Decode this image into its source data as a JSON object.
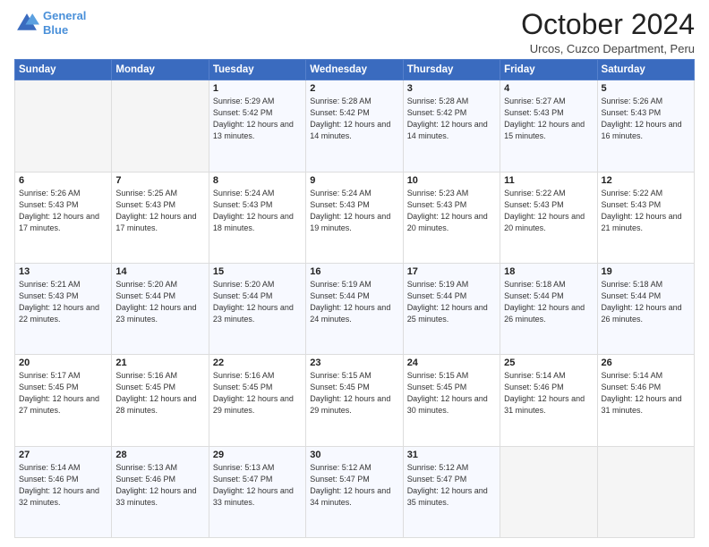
{
  "header": {
    "logo_line1": "General",
    "logo_line2": "Blue",
    "month_title": "October 2024",
    "location": "Urcos, Cuzco Department, Peru"
  },
  "weekdays": [
    "Sunday",
    "Monday",
    "Tuesday",
    "Wednesday",
    "Thursday",
    "Friday",
    "Saturday"
  ],
  "weeks": [
    [
      {
        "day": "",
        "sunrise": "",
        "sunset": "",
        "daylight": ""
      },
      {
        "day": "",
        "sunrise": "",
        "sunset": "",
        "daylight": ""
      },
      {
        "day": "1",
        "sunrise": "Sunrise: 5:29 AM",
        "sunset": "Sunset: 5:42 PM",
        "daylight": "Daylight: 12 hours and 13 minutes."
      },
      {
        "day": "2",
        "sunrise": "Sunrise: 5:28 AM",
        "sunset": "Sunset: 5:42 PM",
        "daylight": "Daylight: 12 hours and 14 minutes."
      },
      {
        "day": "3",
        "sunrise": "Sunrise: 5:28 AM",
        "sunset": "Sunset: 5:42 PM",
        "daylight": "Daylight: 12 hours and 14 minutes."
      },
      {
        "day": "4",
        "sunrise": "Sunrise: 5:27 AM",
        "sunset": "Sunset: 5:43 PM",
        "daylight": "Daylight: 12 hours and 15 minutes."
      },
      {
        "day": "5",
        "sunrise": "Sunrise: 5:26 AM",
        "sunset": "Sunset: 5:43 PM",
        "daylight": "Daylight: 12 hours and 16 minutes."
      }
    ],
    [
      {
        "day": "6",
        "sunrise": "Sunrise: 5:26 AM",
        "sunset": "Sunset: 5:43 PM",
        "daylight": "Daylight: 12 hours and 17 minutes."
      },
      {
        "day": "7",
        "sunrise": "Sunrise: 5:25 AM",
        "sunset": "Sunset: 5:43 PM",
        "daylight": "Daylight: 12 hours and 17 minutes."
      },
      {
        "day": "8",
        "sunrise": "Sunrise: 5:24 AM",
        "sunset": "Sunset: 5:43 PM",
        "daylight": "Daylight: 12 hours and 18 minutes."
      },
      {
        "day": "9",
        "sunrise": "Sunrise: 5:24 AM",
        "sunset": "Sunset: 5:43 PM",
        "daylight": "Daylight: 12 hours and 19 minutes."
      },
      {
        "day": "10",
        "sunrise": "Sunrise: 5:23 AM",
        "sunset": "Sunset: 5:43 PM",
        "daylight": "Daylight: 12 hours and 20 minutes."
      },
      {
        "day": "11",
        "sunrise": "Sunrise: 5:22 AM",
        "sunset": "Sunset: 5:43 PM",
        "daylight": "Daylight: 12 hours and 20 minutes."
      },
      {
        "day": "12",
        "sunrise": "Sunrise: 5:22 AM",
        "sunset": "Sunset: 5:43 PM",
        "daylight": "Daylight: 12 hours and 21 minutes."
      }
    ],
    [
      {
        "day": "13",
        "sunrise": "Sunrise: 5:21 AM",
        "sunset": "Sunset: 5:43 PM",
        "daylight": "Daylight: 12 hours and 22 minutes."
      },
      {
        "day": "14",
        "sunrise": "Sunrise: 5:20 AM",
        "sunset": "Sunset: 5:44 PM",
        "daylight": "Daylight: 12 hours and 23 minutes."
      },
      {
        "day": "15",
        "sunrise": "Sunrise: 5:20 AM",
        "sunset": "Sunset: 5:44 PM",
        "daylight": "Daylight: 12 hours and 23 minutes."
      },
      {
        "day": "16",
        "sunrise": "Sunrise: 5:19 AM",
        "sunset": "Sunset: 5:44 PM",
        "daylight": "Daylight: 12 hours and 24 minutes."
      },
      {
        "day": "17",
        "sunrise": "Sunrise: 5:19 AM",
        "sunset": "Sunset: 5:44 PM",
        "daylight": "Daylight: 12 hours and 25 minutes."
      },
      {
        "day": "18",
        "sunrise": "Sunrise: 5:18 AM",
        "sunset": "Sunset: 5:44 PM",
        "daylight": "Daylight: 12 hours and 26 minutes."
      },
      {
        "day": "19",
        "sunrise": "Sunrise: 5:18 AM",
        "sunset": "Sunset: 5:44 PM",
        "daylight": "Daylight: 12 hours and 26 minutes."
      }
    ],
    [
      {
        "day": "20",
        "sunrise": "Sunrise: 5:17 AM",
        "sunset": "Sunset: 5:45 PM",
        "daylight": "Daylight: 12 hours and 27 minutes."
      },
      {
        "day": "21",
        "sunrise": "Sunrise: 5:16 AM",
        "sunset": "Sunset: 5:45 PM",
        "daylight": "Daylight: 12 hours and 28 minutes."
      },
      {
        "day": "22",
        "sunrise": "Sunrise: 5:16 AM",
        "sunset": "Sunset: 5:45 PM",
        "daylight": "Daylight: 12 hours and 29 minutes."
      },
      {
        "day": "23",
        "sunrise": "Sunrise: 5:15 AM",
        "sunset": "Sunset: 5:45 PM",
        "daylight": "Daylight: 12 hours and 29 minutes."
      },
      {
        "day": "24",
        "sunrise": "Sunrise: 5:15 AM",
        "sunset": "Sunset: 5:45 PM",
        "daylight": "Daylight: 12 hours and 30 minutes."
      },
      {
        "day": "25",
        "sunrise": "Sunrise: 5:14 AM",
        "sunset": "Sunset: 5:46 PM",
        "daylight": "Daylight: 12 hours and 31 minutes."
      },
      {
        "day": "26",
        "sunrise": "Sunrise: 5:14 AM",
        "sunset": "Sunset: 5:46 PM",
        "daylight": "Daylight: 12 hours and 31 minutes."
      }
    ],
    [
      {
        "day": "27",
        "sunrise": "Sunrise: 5:14 AM",
        "sunset": "Sunset: 5:46 PM",
        "daylight": "Daylight: 12 hours and 32 minutes."
      },
      {
        "day": "28",
        "sunrise": "Sunrise: 5:13 AM",
        "sunset": "Sunset: 5:46 PM",
        "daylight": "Daylight: 12 hours and 33 minutes."
      },
      {
        "day": "29",
        "sunrise": "Sunrise: 5:13 AM",
        "sunset": "Sunset: 5:47 PM",
        "daylight": "Daylight: 12 hours and 33 minutes."
      },
      {
        "day": "30",
        "sunrise": "Sunrise: 5:12 AM",
        "sunset": "Sunset: 5:47 PM",
        "daylight": "Daylight: 12 hours and 34 minutes."
      },
      {
        "day": "31",
        "sunrise": "Sunrise: 5:12 AM",
        "sunset": "Sunset: 5:47 PM",
        "daylight": "Daylight: 12 hours and 35 minutes."
      },
      {
        "day": "",
        "sunrise": "",
        "sunset": "",
        "daylight": ""
      },
      {
        "day": "",
        "sunrise": "",
        "sunset": "",
        "daylight": ""
      }
    ]
  ]
}
